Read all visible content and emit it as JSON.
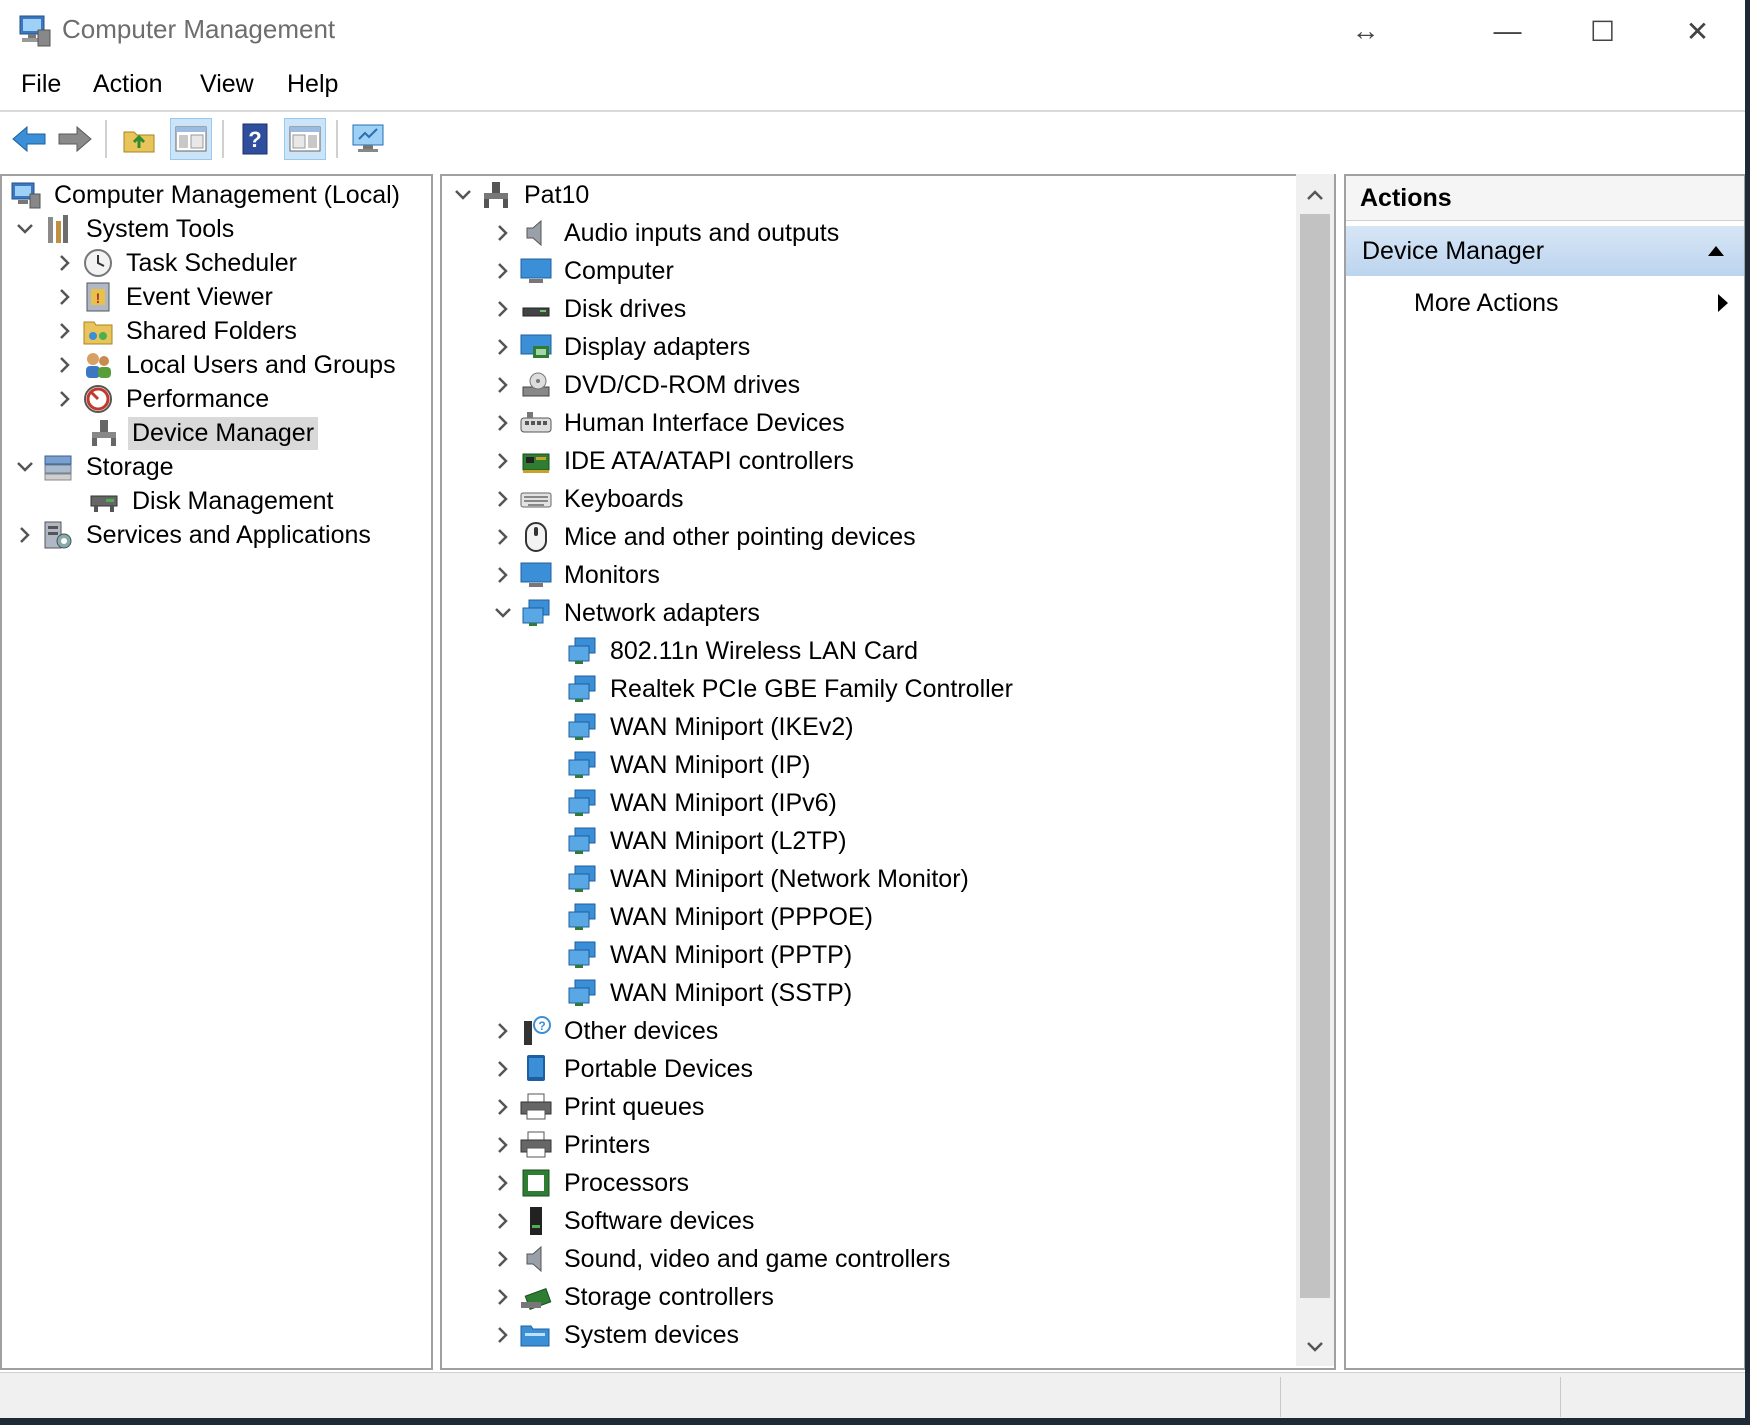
{
  "window": {
    "title": "Computer Management",
    "controls": {
      "resize": "↔",
      "minimize": "—",
      "maximize": "☐",
      "close": "✕"
    }
  },
  "menu": {
    "file": "File",
    "action": "Action",
    "view": "View",
    "help": "Help"
  },
  "toolbar": {
    "icons": [
      "back-arrow-icon",
      "forward-arrow-icon",
      "up-folder-icon",
      "show-hide-console-tree-icon",
      "help-icon",
      "show-hide-action-pane-icon",
      "monitor-properties-icon"
    ]
  },
  "left_tree": {
    "root": "Computer Management (Local)",
    "system_tools": "System Tools",
    "task_scheduler": "Task Scheduler",
    "event_viewer": "Event Viewer",
    "shared_folders": "Shared Folders",
    "local_users": "Local Users and Groups",
    "performance": "Performance",
    "device_manager": "Device Manager",
    "storage": "Storage",
    "disk_management": "Disk Management",
    "services": "Services and Applications"
  },
  "device_tree": {
    "computer_name": "Pat10",
    "categories_before": [
      {
        "label": "Audio inputs and outputs",
        "icon": "speaker-icon"
      },
      {
        "label": "Computer",
        "icon": "computer-icon"
      },
      {
        "label": "Disk drives",
        "icon": "disk-drive-icon"
      },
      {
        "label": "Display adapters",
        "icon": "display-adapter-icon"
      },
      {
        "label": "DVD/CD-ROM drives",
        "icon": "dvd-drive-icon"
      },
      {
        "label": "Human Interface Devices",
        "icon": "hid-icon"
      },
      {
        "label": "IDE ATA/ATAPI controllers",
        "icon": "ide-controller-icon"
      },
      {
        "label": "Keyboards",
        "icon": "keyboard-icon"
      },
      {
        "label": "Mice and other pointing devices",
        "icon": "mouse-icon"
      },
      {
        "label": "Monitors",
        "icon": "monitor-icon"
      }
    ],
    "network_adapters": "Network adapters",
    "network_children": [
      "802.11n Wireless LAN Card",
      "Realtek PCIe GBE Family Controller",
      "WAN Miniport (IKEv2)",
      "WAN Miniport (IP)",
      "WAN Miniport (IPv6)",
      "WAN Miniport (L2TP)",
      "WAN Miniport (Network Monitor)",
      "WAN Miniport (PPPOE)",
      "WAN Miniport (PPTP)",
      "WAN Miniport (SSTP)"
    ],
    "categories_after": [
      {
        "label": "Other devices",
        "icon": "unknown-device-icon"
      },
      {
        "label": "Portable Devices",
        "icon": "portable-device-icon"
      },
      {
        "label": "Print queues",
        "icon": "printer-queue-icon"
      },
      {
        "label": "Printers",
        "icon": "printer-icon"
      },
      {
        "label": "Processors",
        "icon": "processor-icon"
      },
      {
        "label": "Software devices",
        "icon": "software-device-icon"
      },
      {
        "label": "Sound, video and game controllers",
        "icon": "sound-icon"
      },
      {
        "label": "Storage controllers",
        "icon": "storage-controller-icon"
      },
      {
        "label": "System devices",
        "icon": "system-device-icon"
      }
    ]
  },
  "actions": {
    "title": "Actions",
    "section": "Device Manager",
    "more": "More Actions"
  },
  "colors": {
    "selection": "#d9d9d9",
    "actions_header": "#c9dcf1",
    "network_icon": "#3a8fd6"
  }
}
